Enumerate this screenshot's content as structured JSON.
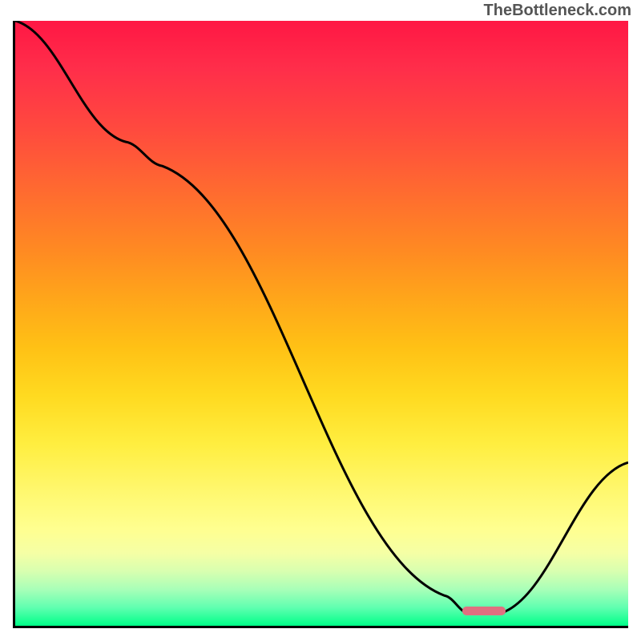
{
  "watermark": "TheBottleneck.com",
  "chart_data": {
    "type": "line",
    "title": "",
    "xlabel": "",
    "ylabel": "",
    "xlim": [
      0,
      100
    ],
    "ylim": [
      0,
      100
    ],
    "x": [
      0,
      18,
      24,
      70,
      74,
      79,
      100
    ],
    "values": [
      100,
      80,
      76,
      5,
      2,
      2,
      27
    ],
    "marker": {
      "x_start": 73,
      "x_end": 80,
      "y": 2.5
    },
    "gradient_stops": [
      {
        "pos": 0,
        "color": "#ff1744"
      },
      {
        "pos": 50,
        "color": "#ffcc15"
      },
      {
        "pos": 85,
        "color": "#ffff90"
      },
      {
        "pos": 100,
        "color": "#00ff88"
      }
    ]
  }
}
